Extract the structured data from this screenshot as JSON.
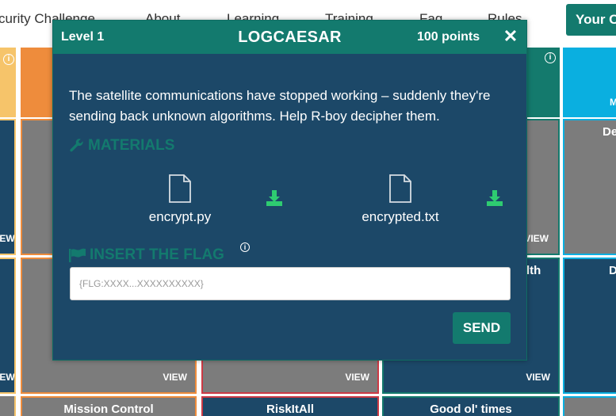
{
  "nav": {
    "brand": "curity Challenge",
    "links": [
      "About",
      "Learning",
      "Training",
      "Faq",
      "Rules"
    ],
    "cta": "Your C"
  },
  "tiles": {
    "view_label": "VIEW",
    "view_label_short": "IEW",
    "info_glyph": "i",
    "bottom_titles": [
      "Mission Control",
      "RiskItAll",
      "Good ol' times"
    ],
    "partial_right_1": "De",
    "partial_right_2": "D",
    "partial_right_m": "M",
    "partial_mid": "lth"
  },
  "modal": {
    "level": "Level 1",
    "title": "LOGCAESAR",
    "points": "100 points",
    "close": "✕",
    "description": "The satellite communications have stopped working – suddenly they're sending back unknown algorithms. Help R-boy decipher them.",
    "materials_heading": "MATERIALS",
    "files": [
      {
        "name": "encrypt.py"
      },
      {
        "name": "encrypted.txt"
      }
    ],
    "flag_heading": "INSERT THE FLAG",
    "flag_placeholder": "{FLG:XXXX...XXXXXXXXXX}",
    "send_label": "SEND",
    "colors": {
      "accent": "#137a6e",
      "panel": "#1c4868",
      "download": "#2ecc71"
    }
  }
}
